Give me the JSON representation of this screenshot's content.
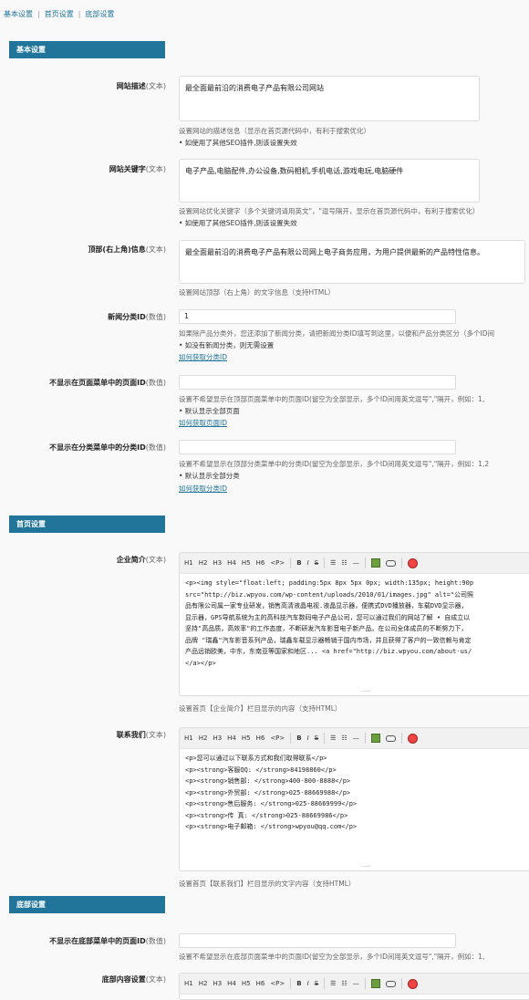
{
  "topnav": [
    "基本设置",
    "首页设置",
    "底部设置"
  ],
  "sections": {
    "basic": "基本设置",
    "home": "首页设置",
    "footer": "底部设置"
  },
  "types": {
    "text": "(文本)",
    "number": "(数值)"
  },
  "fields": {
    "site_desc": {
      "label": "网站描述",
      "value": "最全面最前沿的消费电子产品有限公司网站",
      "desc": "设置网站的描述信息（显示在首页源代码中，有利于搜索优化）",
      "note": "• 如使用了其他SEO插件,则该设置失效"
    },
    "site_keywords": {
      "label": "网站关键字",
      "value": "电子产品,电脑配件,办公设备,数码相机,手机电话,游戏电玩,电脑硬件",
      "desc": "设置网站优化关键字（多个关键词请用英文\"，\"逗号隔开，显示在首页源代码中，有利于搜索优化）",
      "note": "• 如使用了其他SEO插件,则该设置失效"
    },
    "top_info": {
      "label": "顶部(右上角)信息",
      "value": "最全面最前沿的消费电子产品有限公司网上电子商务应用，为用户提供最新的产品特性信息。",
      "desc": "设置网站顶部（右上角）的文字信息（支持HTML）"
    },
    "news_cat": {
      "label": "新闻分类ID",
      "value": "1",
      "desc": "如果除产品分类外，您还添加了新闻分类，请把新闻分类ID填写到这里，以便和产品分类区分（多个ID间",
      "note": "• 如没有新闻分类，则无需设置",
      "link": "如何获取分类ID"
    },
    "hide_pages_top": {
      "label": "不显示在页面菜单中的页面ID",
      "value": "",
      "desc": "设置不希望显示在顶部页面菜单中的页面ID(留空为全部显示，多个ID间用英文逗号\",\"隔开，例如：1,",
      "note": "• 默认显示全部页面",
      "link": "如何获取页面ID"
    },
    "hide_cats": {
      "label": "不显示在分类菜单中的分类ID",
      "value": "",
      "desc": "设置不希望显示在顶部分类菜单中的分类ID(留空为全部显示，多个ID间用英文逗号\",\"隔开，例如：1,2",
      "note": "• 默认显示全部分类",
      "link": "如何获取分类ID"
    },
    "company_intro": {
      "label": "企业简介",
      "lines": [
        "<p><img style=\"float:left; padding:5px 8px 5px 0px; width:135px; height:90p",
        "src=\"http://biz.wpyou.com/wp-content/uploads/2010/01/images.jpg\" alt=\"公司照",
        "品有限公司属一家专业研发，销售高清液晶电视.液晶显示器，便携式DVD播放器，车载DVD显示器，",
        "显示器，GPS导航系统为主的高科技汽车数码电子产品公司，您可以通过我们的网站了解 • 自成立以",
        "坚持\"高品质，高效率\"的工作态度，不断研发汽车影音电子新产品。在公司全体成员的不断努力下，",
        "品牌 \"瑞鑫\"汽车影音系列产品，瑞鑫车载显示器畅销于国内市场，并且获得了客户的一致信赖与肯定",
        "产品远销欧美，中东，东南亚等国家和地区... <a href=\"http://biz.wpyou.com/about-us/",
        "</a></p>"
      ],
      "desc": "设置首页【企业简介】栏目显示的内容（支持HTML）"
    },
    "contact": {
      "label": "联系我们",
      "lines": [
        "<p>您可以通过以下联系方式和我们取得联系</p>",
        "<p><strong>客服QQ: </strong>84198860</p>",
        "<p><strong>销售部: </strong>400-800-8888</p>",
        "<p><strong>外贸部: </strong>025-88669988</p>",
        "<p><strong>售后服务: </strong>025-88669999</p>",
        "<p><strong>传 真: </strong>025-88669986</p>",
        "<p><strong>电子邮箱: </strong>wpyou@qq.com</p>"
      ],
      "desc": "设置首页【联系我们】栏目显示的文字内容（支持HTML）"
    },
    "hide_pages_footer": {
      "label": "不显示在底部菜单中的页面ID",
      "value": "",
      "desc": "设置不希望显示在底部页面菜单中的页面ID(留空为全部显示，多个ID间用英文逗号\",\"隔开，例如：1,"
    },
    "footer_content": {
      "label": "底部内容设置"
    }
  },
  "toolbar": {
    "headings": [
      "H1",
      "H2",
      "H3",
      "H4",
      "H5",
      "H6",
      "<P>"
    ],
    "bold": "B",
    "italic": "I",
    "strike": "S",
    "icons": [
      "ordered-list-icon",
      "unordered-list-icon",
      "horizontal-rule-icon",
      "image-icon",
      "link-icon",
      "spellcheck-icon"
    ]
  },
  "colors": {
    "accent": "#21759b",
    "background": "#f9f9f9"
  }
}
